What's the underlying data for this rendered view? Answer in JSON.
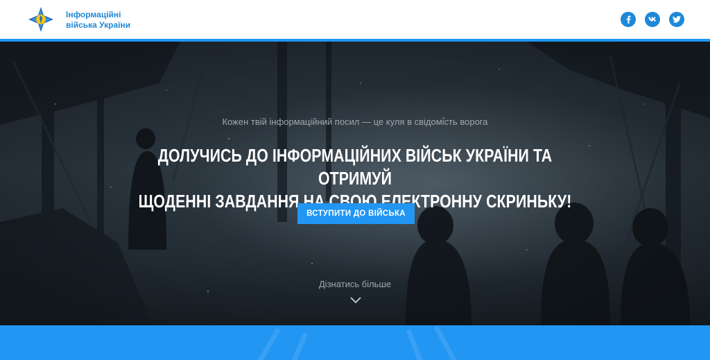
{
  "header": {
    "logo_line1": "Інформаційні",
    "logo_line2": "війська України",
    "socials": [
      "facebook-icon",
      "vk-icon",
      "twitter-icon"
    ]
  },
  "hero": {
    "tagline": "Кожен твій інформаційний посил — це куля в свідомість ворога",
    "headline_line1": "ДОЛУЧИСЬ ДО ІНФОРМАЦІЙНИХ ВІЙСЬК УКРАЇНИ ТА ОТРИМУЙ",
    "headline_line2": "ЩОДЕННІ ЗАВДАННЯ НА СВОЮ ЕЛЕКТРОННУ СКРИНЬКУ!",
    "cta_label": "ВСТУПИТИ ДО ВІЙСЬКА",
    "more_label": "Дізнатись більше"
  },
  "colors": {
    "accent": "#2196f3",
    "logo_text": "#1e88d8",
    "header_bg": "#ffffff"
  }
}
